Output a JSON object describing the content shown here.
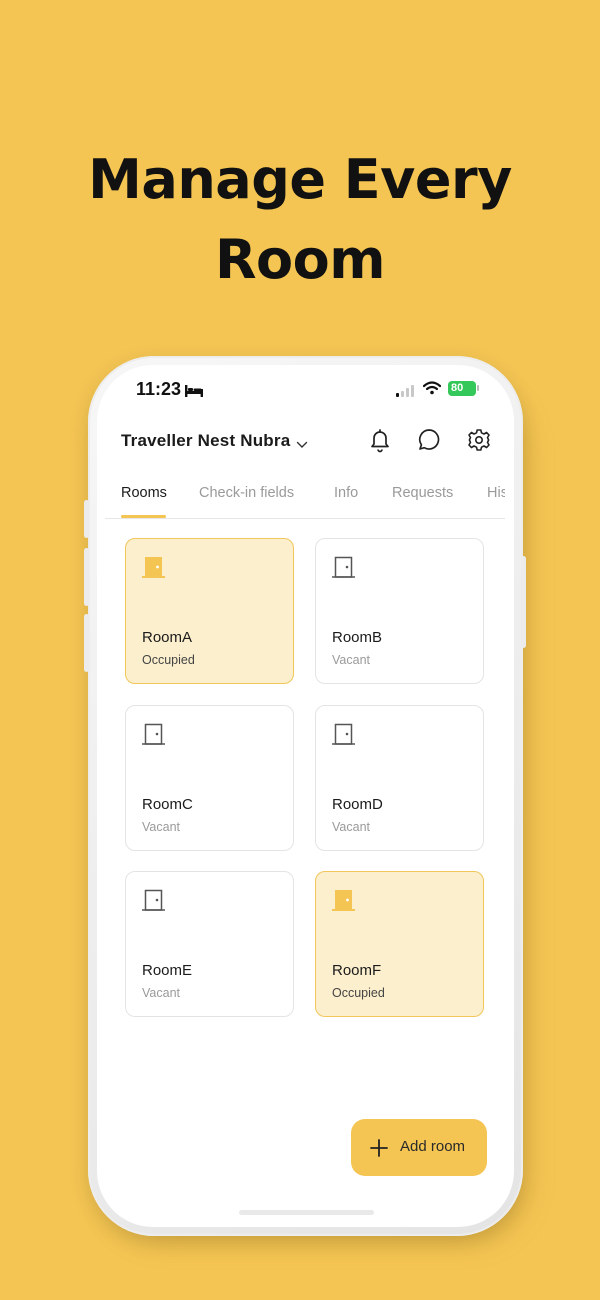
{
  "headline": {
    "line1": "Manage Every",
    "line2": "Room"
  },
  "status_bar": {
    "time": "11:23",
    "battery": "80"
  },
  "header": {
    "property_name": "Traveller Nest Nubra"
  },
  "tabs": [
    {
      "label": "Rooms",
      "active": true
    },
    {
      "label": "Check-in fields",
      "active": false
    },
    {
      "label": "Info",
      "active": false
    },
    {
      "label": "Requests",
      "active": false
    },
    {
      "label": "His",
      "active": false
    }
  ],
  "rooms": [
    {
      "name": "RoomA",
      "status": "Occupied"
    },
    {
      "name": "RoomB",
      "status": "Vacant"
    },
    {
      "name": "RoomC",
      "status": "Vacant"
    },
    {
      "name": "RoomD",
      "status": "Vacant"
    },
    {
      "name": "RoomE",
      "status": "Vacant"
    },
    {
      "name": "RoomF",
      "status": "Occupied"
    }
  ],
  "add_button": {
    "label": "Add room"
  },
  "colors": {
    "accent": "#F4C553",
    "occupied_bg": "#FCEFCD",
    "occupied_border": "#F1C75B",
    "battery": "#34C759"
  },
  "icons": [
    "bed-icon",
    "signal-icon",
    "wifi-icon",
    "battery-icon",
    "chevron-down-icon",
    "bell-icon",
    "chat-icon",
    "gear-icon",
    "door-icon",
    "plus-icon"
  ]
}
